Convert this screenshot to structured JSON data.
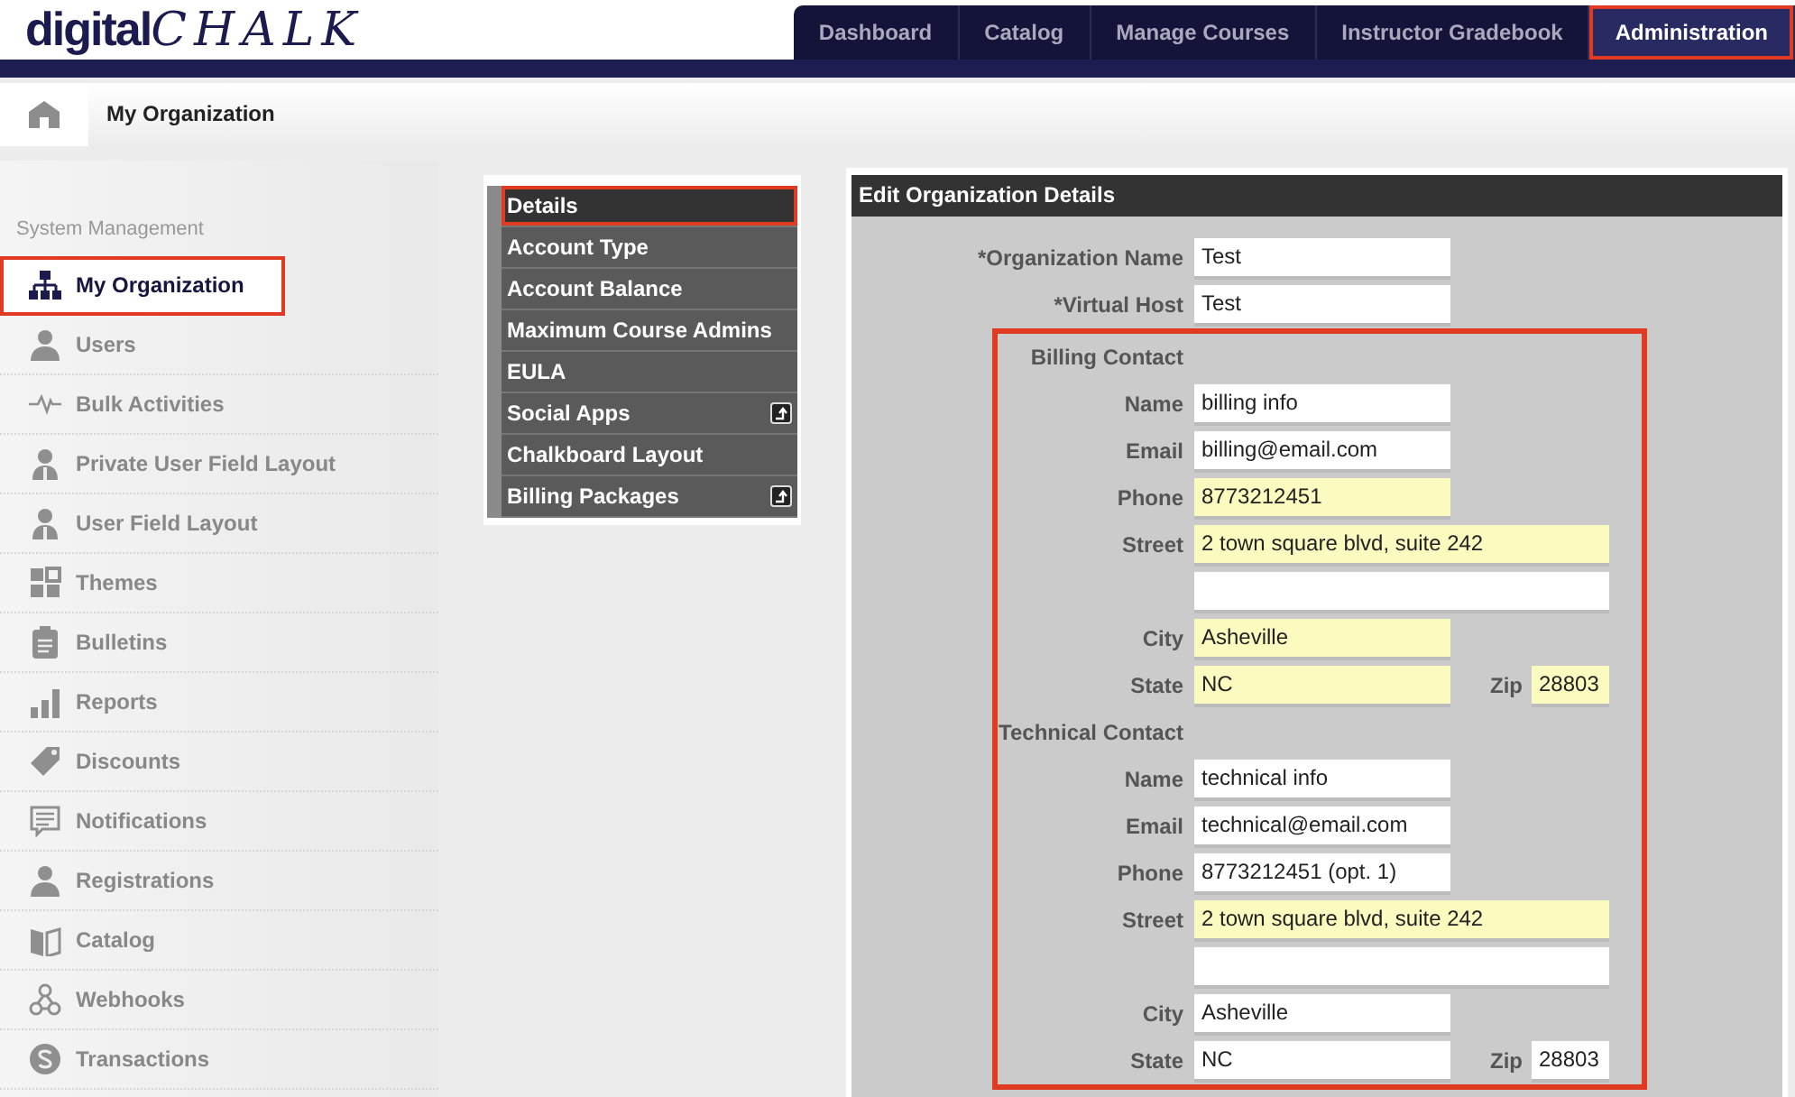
{
  "logo": {
    "text": "digital",
    "script": "CHALK"
  },
  "tabs": [
    {
      "label": "Dashboard",
      "selected": false,
      "highlighted": false
    },
    {
      "label": "Catalog",
      "selected": false,
      "highlighted": false
    },
    {
      "label": "Manage Courses",
      "selected": false,
      "highlighted": false
    },
    {
      "label": "Instructor Gradebook",
      "selected": false,
      "highlighted": false
    },
    {
      "label": "Administration",
      "selected": true,
      "highlighted": true
    }
  ],
  "breadcrumb": {
    "title": "My Organization"
  },
  "sidebar": {
    "heading": "System Management",
    "items": [
      {
        "label": "My Organization",
        "selected": true,
        "highlighted": true
      },
      {
        "label": "Users",
        "selected": false,
        "highlighted": false
      },
      {
        "label": "Bulk Activities",
        "selected": false,
        "highlighted": false
      },
      {
        "label": "Private User Field Layout",
        "selected": false,
        "highlighted": false
      },
      {
        "label": "User Field Layout",
        "selected": false,
        "highlighted": false
      },
      {
        "label": "Themes",
        "selected": false,
        "highlighted": false
      },
      {
        "label": "Bulletins",
        "selected": false,
        "highlighted": false
      },
      {
        "label": "Reports",
        "selected": false,
        "highlighted": false
      },
      {
        "label": "Discounts",
        "selected": false,
        "highlighted": false
      },
      {
        "label": "Notifications",
        "selected": false,
        "highlighted": false
      },
      {
        "label": "Registrations",
        "selected": false,
        "highlighted": false
      },
      {
        "label": "Catalog",
        "selected": false,
        "highlighted": false
      },
      {
        "label": "Webhooks",
        "selected": false,
        "highlighted": false
      },
      {
        "label": "Transactions",
        "selected": false,
        "highlighted": false
      }
    ]
  },
  "settings_menu": {
    "items": [
      {
        "label": "Details",
        "selected": true,
        "highlighted": true,
        "submenu": false
      },
      {
        "label": "Account Type",
        "selected": false,
        "highlighted": false,
        "submenu": false
      },
      {
        "label": "Account Balance",
        "selected": false,
        "highlighted": false,
        "submenu": false
      },
      {
        "label": "Maximum Course Admins",
        "selected": false,
        "highlighted": false,
        "submenu": false
      },
      {
        "label": "EULA",
        "selected": false,
        "highlighted": false,
        "submenu": false
      },
      {
        "label": "Social Apps",
        "selected": false,
        "highlighted": false,
        "submenu": true
      },
      {
        "label": "Chalkboard Layout",
        "selected": false,
        "highlighted": false,
        "submenu": false
      },
      {
        "label": "Billing Packages",
        "selected": false,
        "highlighted": false,
        "submenu": true
      }
    ]
  },
  "form": {
    "title": "Edit Organization Details",
    "fields": [
      {
        "label": "*Organization Name",
        "value": "Test",
        "autofilled": false
      },
      {
        "label": "*Virtual Host",
        "value": "Test",
        "autofilled": false
      }
    ],
    "contacts_highlighted": true,
    "contacts": [
      {
        "title": "Billing Contact",
        "fields": [
          {
            "kind": "text",
            "label": "Name",
            "value": "billing info",
            "autofilled": false
          },
          {
            "kind": "text",
            "label": "Email",
            "value": "billing@email.com",
            "autofilled": false
          },
          {
            "kind": "text",
            "label": "Phone",
            "value": "8773212451",
            "autofilled": true
          },
          {
            "kind": "wide",
            "label": "Street",
            "value": "2 town square blvd, suite 242",
            "autofilled": true
          },
          {
            "kind": "wide",
            "autofilled": false
          },
          {
            "kind": "text",
            "label": "City",
            "value": "Asheville",
            "autofilled": true
          },
          {
            "kind": "pair",
            "label": "State",
            "value": "NC",
            "autofilled": true,
            "label_2": "Zip",
            "value_2": "28803",
            "autofilled_2": true
          }
        ]
      },
      {
        "title": "Technical Contact",
        "fields": [
          {
            "kind": "text",
            "label": "Name",
            "value": "technical info",
            "autofilled": false
          },
          {
            "kind": "text",
            "label": "Email",
            "value": "technical@email.com",
            "autofilled": false
          },
          {
            "kind": "text",
            "label": "Phone",
            "value": "8773212451 (opt. 1)",
            "autofilled": false
          },
          {
            "kind": "wide",
            "label": "Street",
            "value": "2 town square blvd, suite 242",
            "autofilled": true
          },
          {
            "kind": "wide",
            "autofilled": false
          },
          {
            "kind": "text",
            "label": "City",
            "value": "Asheville",
            "autofilled": false
          },
          {
            "kind": "pair",
            "label": "State",
            "value": "NC",
            "autofilled": false,
            "label_2": "Zip",
            "value_2": "28803",
            "autofilled_2": false
          }
        ]
      }
    ]
  }
}
